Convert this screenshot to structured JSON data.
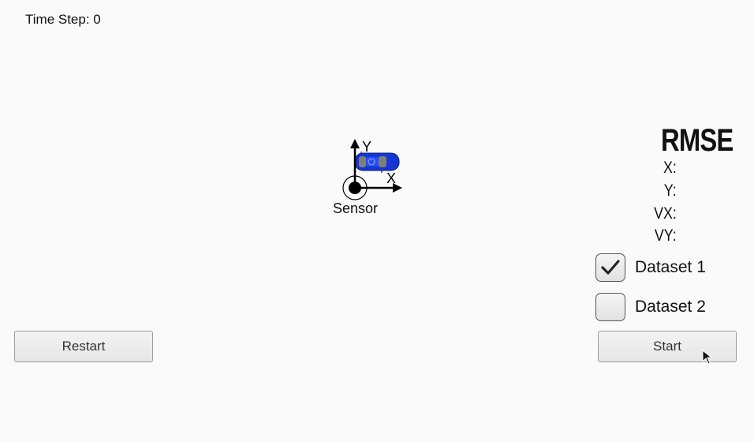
{
  "status": {
    "time_step_label": "Time Step: ",
    "time_step_value": "0"
  },
  "scene": {
    "sensor_label": "Sensor",
    "axis_x_label": "X",
    "axis_y_label": "Y",
    "car_color": "#1436d4",
    "car_icon": "car-icon",
    "sensor_icon": "sensor-icon"
  },
  "rmse": {
    "title": "RMSE",
    "rows": [
      {
        "label": "X:",
        "value": ""
      },
      {
        "label": "Y:",
        "value": ""
      },
      {
        "label": "VX:",
        "value": ""
      },
      {
        "label": "VY:",
        "value": ""
      }
    ]
  },
  "datasets": [
    {
      "label": "Dataset 1",
      "checked": true
    },
    {
      "label": "Dataset 2",
      "checked": false
    }
  ],
  "buttons": {
    "restart_label": "Restart",
    "start_label": "Start"
  }
}
